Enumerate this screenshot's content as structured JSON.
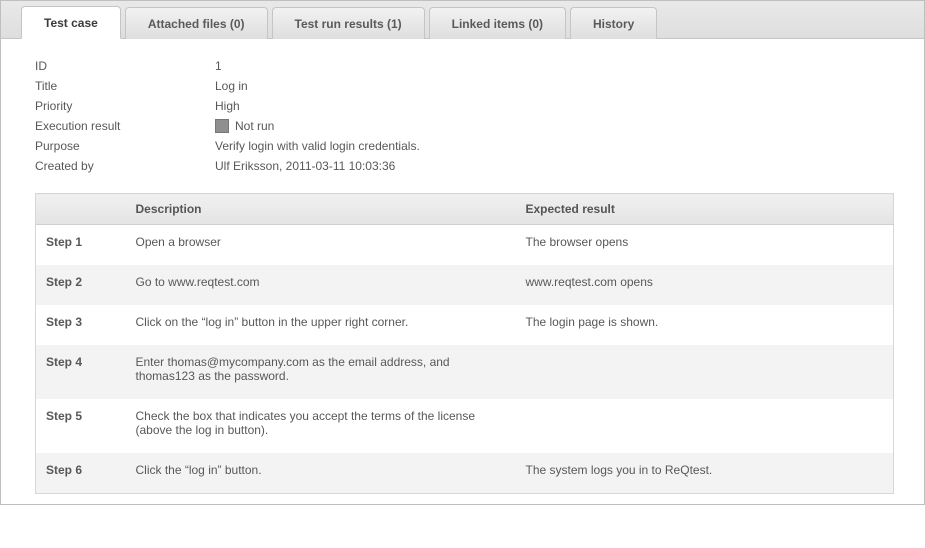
{
  "tabs": [
    {
      "label": "Test case",
      "active": true
    },
    {
      "label": "Attached files (0)",
      "active": false
    },
    {
      "label": "Test run results (1)",
      "active": false
    },
    {
      "label": "Linked items (0)",
      "active": false
    },
    {
      "label": "History",
      "active": false
    }
  ],
  "details": {
    "id_label": "ID",
    "id_value": "1",
    "title_label": "Title",
    "title_value": "Log in",
    "priority_label": "Priority",
    "priority_value": "High",
    "exec_label": "Execution result",
    "exec_value": "Not run",
    "purpose_label": "Purpose",
    "purpose_value": "Verify login with valid login credentials.",
    "created_label": "Created by",
    "created_value": "Ulf Eriksson, 2011-03-11 10:03:36"
  },
  "table": {
    "headers": {
      "step": "",
      "description": "Description",
      "expected": "Expected result"
    },
    "rows": [
      {
        "step": "Step 1",
        "description": "Open a browser",
        "expected": "The browser opens"
      },
      {
        "step": "Step 2",
        "description": "Go to www.reqtest.com",
        "expected": "www.reqtest.com opens"
      },
      {
        "step": "Step 3",
        "description": "Click on the “log in” button in the upper right corner.",
        "expected": "The login page is shown."
      },
      {
        "step": "Step 4",
        "description": "Enter thomas@mycompany.com as the email address, and thomas123 as the password.",
        "expected": ""
      },
      {
        "step": "Step 5",
        "description": "Check the box that indicates you accept the terms of the license (above the log in button).",
        "expected": ""
      },
      {
        "step": "Step 6",
        "description": "Click the “log in” button.",
        "expected": "The system logs you in to ReQtest."
      }
    ]
  }
}
